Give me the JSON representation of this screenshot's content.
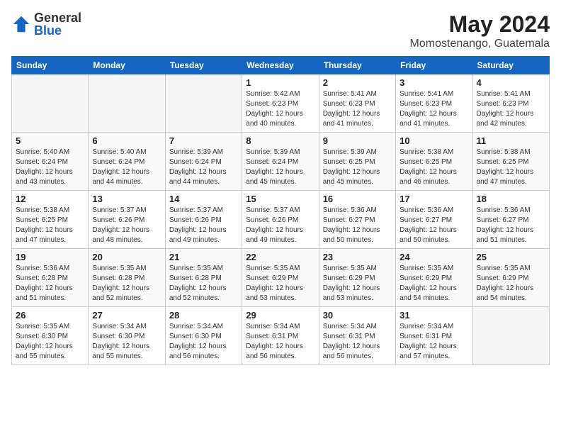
{
  "header": {
    "logo": {
      "general": "General",
      "blue": "Blue"
    },
    "title": "May 2024",
    "location": "Momostenango, Guatemala"
  },
  "weekdays": [
    "Sunday",
    "Monday",
    "Tuesday",
    "Wednesday",
    "Thursday",
    "Friday",
    "Saturday"
  ],
  "weeks": [
    [
      {
        "day": null
      },
      {
        "day": null
      },
      {
        "day": null
      },
      {
        "day": 1,
        "sunrise": "5:42 AM",
        "sunset": "6:23 PM",
        "daylight": "12 hours and 40 minutes."
      },
      {
        "day": 2,
        "sunrise": "5:41 AM",
        "sunset": "6:23 PM",
        "daylight": "12 hours and 41 minutes."
      },
      {
        "day": 3,
        "sunrise": "5:41 AM",
        "sunset": "6:23 PM",
        "daylight": "12 hours and 41 minutes."
      },
      {
        "day": 4,
        "sunrise": "5:41 AM",
        "sunset": "6:23 PM",
        "daylight": "12 hours and 42 minutes."
      }
    ],
    [
      {
        "day": 5,
        "sunrise": "5:40 AM",
        "sunset": "6:24 PM",
        "daylight": "12 hours and 43 minutes."
      },
      {
        "day": 6,
        "sunrise": "5:40 AM",
        "sunset": "6:24 PM",
        "daylight": "12 hours and 44 minutes."
      },
      {
        "day": 7,
        "sunrise": "5:39 AM",
        "sunset": "6:24 PM",
        "daylight": "12 hours and 44 minutes."
      },
      {
        "day": 8,
        "sunrise": "5:39 AM",
        "sunset": "6:24 PM",
        "daylight": "12 hours and 45 minutes."
      },
      {
        "day": 9,
        "sunrise": "5:39 AM",
        "sunset": "6:25 PM",
        "daylight": "12 hours and 45 minutes."
      },
      {
        "day": 10,
        "sunrise": "5:38 AM",
        "sunset": "6:25 PM",
        "daylight": "12 hours and 46 minutes."
      },
      {
        "day": 11,
        "sunrise": "5:38 AM",
        "sunset": "6:25 PM",
        "daylight": "12 hours and 47 minutes."
      }
    ],
    [
      {
        "day": 12,
        "sunrise": "5:38 AM",
        "sunset": "6:25 PM",
        "daylight": "12 hours and 47 minutes."
      },
      {
        "day": 13,
        "sunrise": "5:37 AM",
        "sunset": "6:26 PM",
        "daylight": "12 hours and 48 minutes."
      },
      {
        "day": 14,
        "sunrise": "5:37 AM",
        "sunset": "6:26 PM",
        "daylight": "12 hours and 49 minutes."
      },
      {
        "day": 15,
        "sunrise": "5:37 AM",
        "sunset": "6:26 PM",
        "daylight": "12 hours and 49 minutes."
      },
      {
        "day": 16,
        "sunrise": "5:36 AM",
        "sunset": "6:27 PM",
        "daylight": "12 hours and 50 minutes."
      },
      {
        "day": 17,
        "sunrise": "5:36 AM",
        "sunset": "6:27 PM",
        "daylight": "12 hours and 50 minutes."
      },
      {
        "day": 18,
        "sunrise": "5:36 AM",
        "sunset": "6:27 PM",
        "daylight": "12 hours and 51 minutes."
      }
    ],
    [
      {
        "day": 19,
        "sunrise": "5:36 AM",
        "sunset": "6:28 PM",
        "daylight": "12 hours and 51 minutes."
      },
      {
        "day": 20,
        "sunrise": "5:35 AM",
        "sunset": "6:28 PM",
        "daylight": "12 hours and 52 minutes."
      },
      {
        "day": 21,
        "sunrise": "5:35 AM",
        "sunset": "6:28 PM",
        "daylight": "12 hours and 52 minutes."
      },
      {
        "day": 22,
        "sunrise": "5:35 AM",
        "sunset": "6:29 PM",
        "daylight": "12 hours and 53 minutes."
      },
      {
        "day": 23,
        "sunrise": "5:35 AM",
        "sunset": "6:29 PM",
        "daylight": "12 hours and 53 minutes."
      },
      {
        "day": 24,
        "sunrise": "5:35 AM",
        "sunset": "6:29 PM",
        "daylight": "12 hours and 54 minutes."
      },
      {
        "day": 25,
        "sunrise": "5:35 AM",
        "sunset": "6:29 PM",
        "daylight": "12 hours and 54 minutes."
      }
    ],
    [
      {
        "day": 26,
        "sunrise": "5:35 AM",
        "sunset": "6:30 PM",
        "daylight": "12 hours and 55 minutes."
      },
      {
        "day": 27,
        "sunrise": "5:34 AM",
        "sunset": "6:30 PM",
        "daylight": "12 hours and 55 minutes."
      },
      {
        "day": 28,
        "sunrise": "5:34 AM",
        "sunset": "6:30 PM",
        "daylight": "12 hours and 56 minutes."
      },
      {
        "day": 29,
        "sunrise": "5:34 AM",
        "sunset": "6:31 PM",
        "daylight": "12 hours and 56 minutes."
      },
      {
        "day": 30,
        "sunrise": "5:34 AM",
        "sunset": "6:31 PM",
        "daylight": "12 hours and 56 minutes."
      },
      {
        "day": 31,
        "sunrise": "5:34 AM",
        "sunset": "6:31 PM",
        "daylight": "12 hours and 57 minutes."
      },
      {
        "day": null
      }
    ]
  ]
}
